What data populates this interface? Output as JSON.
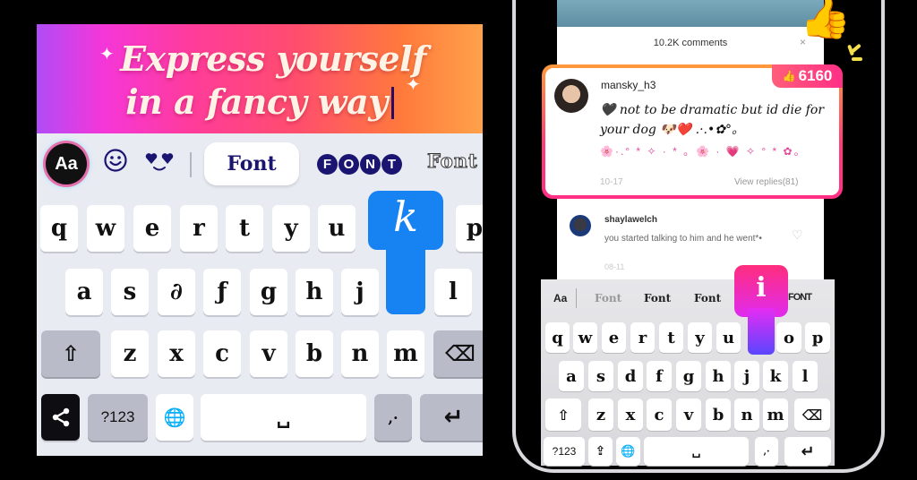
{
  "left_keyboard": {
    "banner": {
      "line1": "Express yourself",
      "line2": "in a fancy way",
      "sparkle": "✦"
    },
    "toolbar": {
      "aa_label": "Aa",
      "emoji_icon": "smiley-icon",
      "hearts_icon": "heart-eyes-icon",
      "font_styles": [
        "Font",
        "FONT",
        "Font"
      ]
    },
    "rows": [
      [
        "q",
        "w",
        "e",
        "r",
        "t",
        "y",
        "u",
        "",
        "",
        "p"
      ],
      [
        "a",
        "s",
        "∂",
        "ƒ",
        "g",
        "h",
        "j",
        "",
        "l"
      ],
      [
        "z",
        "x",
        "c",
        "v",
        "b",
        "n",
        "m"
      ]
    ],
    "popup_key": "k",
    "popup_color": "#1782f2",
    "shift_icon": "⇧",
    "backspace_icon": "⌫",
    "share_icon": "share-icon",
    "symbols_label": "?123",
    "globe_icon": "🌐",
    "space_icon": "␣",
    "punct_label": ",·",
    "enter_icon": "↵"
  },
  "phone": {
    "comments_count": "10.2K comments",
    "close_icon": "×",
    "featured_comment": {
      "user": "mansky_h3",
      "text": "🖤 not to be dramatic but id die for your dog 🐶❤️ .·.•✿°。",
      "decoration": "🌸·.° * ✧ · * 。🌸 · 💗 ✧ ° * ✿。",
      "time": "10-17",
      "replies": "View replies(81)",
      "likes": "6160",
      "like_icon": "👍"
    },
    "second_comment": {
      "user": "shaylawelch",
      "text": "you started talking to him and he went*•",
      "time": "08-11",
      "like_icon": "♡"
    },
    "thumbs_up": "👍",
    "keyboard": {
      "toolbar": [
        "Aa",
        "Font",
        "Font",
        "Font",
        "FONT"
      ],
      "rows": [
        [
          "q",
          "w",
          "e",
          "r",
          "t",
          "y",
          "u",
          "",
          "o",
          "p"
        ],
        [
          "a",
          "s",
          "d",
          "f",
          "g",
          "h",
          "j",
          "k",
          "l"
        ],
        [
          "z",
          "x",
          "c",
          "v",
          "b",
          "n",
          "m"
        ]
      ],
      "popup_key": "i",
      "symbols_label": "?123",
      "upload_icon": "⇪",
      "globe_icon": "🌐",
      "space_icon": "␣",
      "punct_label": ",·",
      "enter_icon": "↵",
      "shift_icon": "⇧",
      "backspace_icon": "⌫"
    }
  }
}
